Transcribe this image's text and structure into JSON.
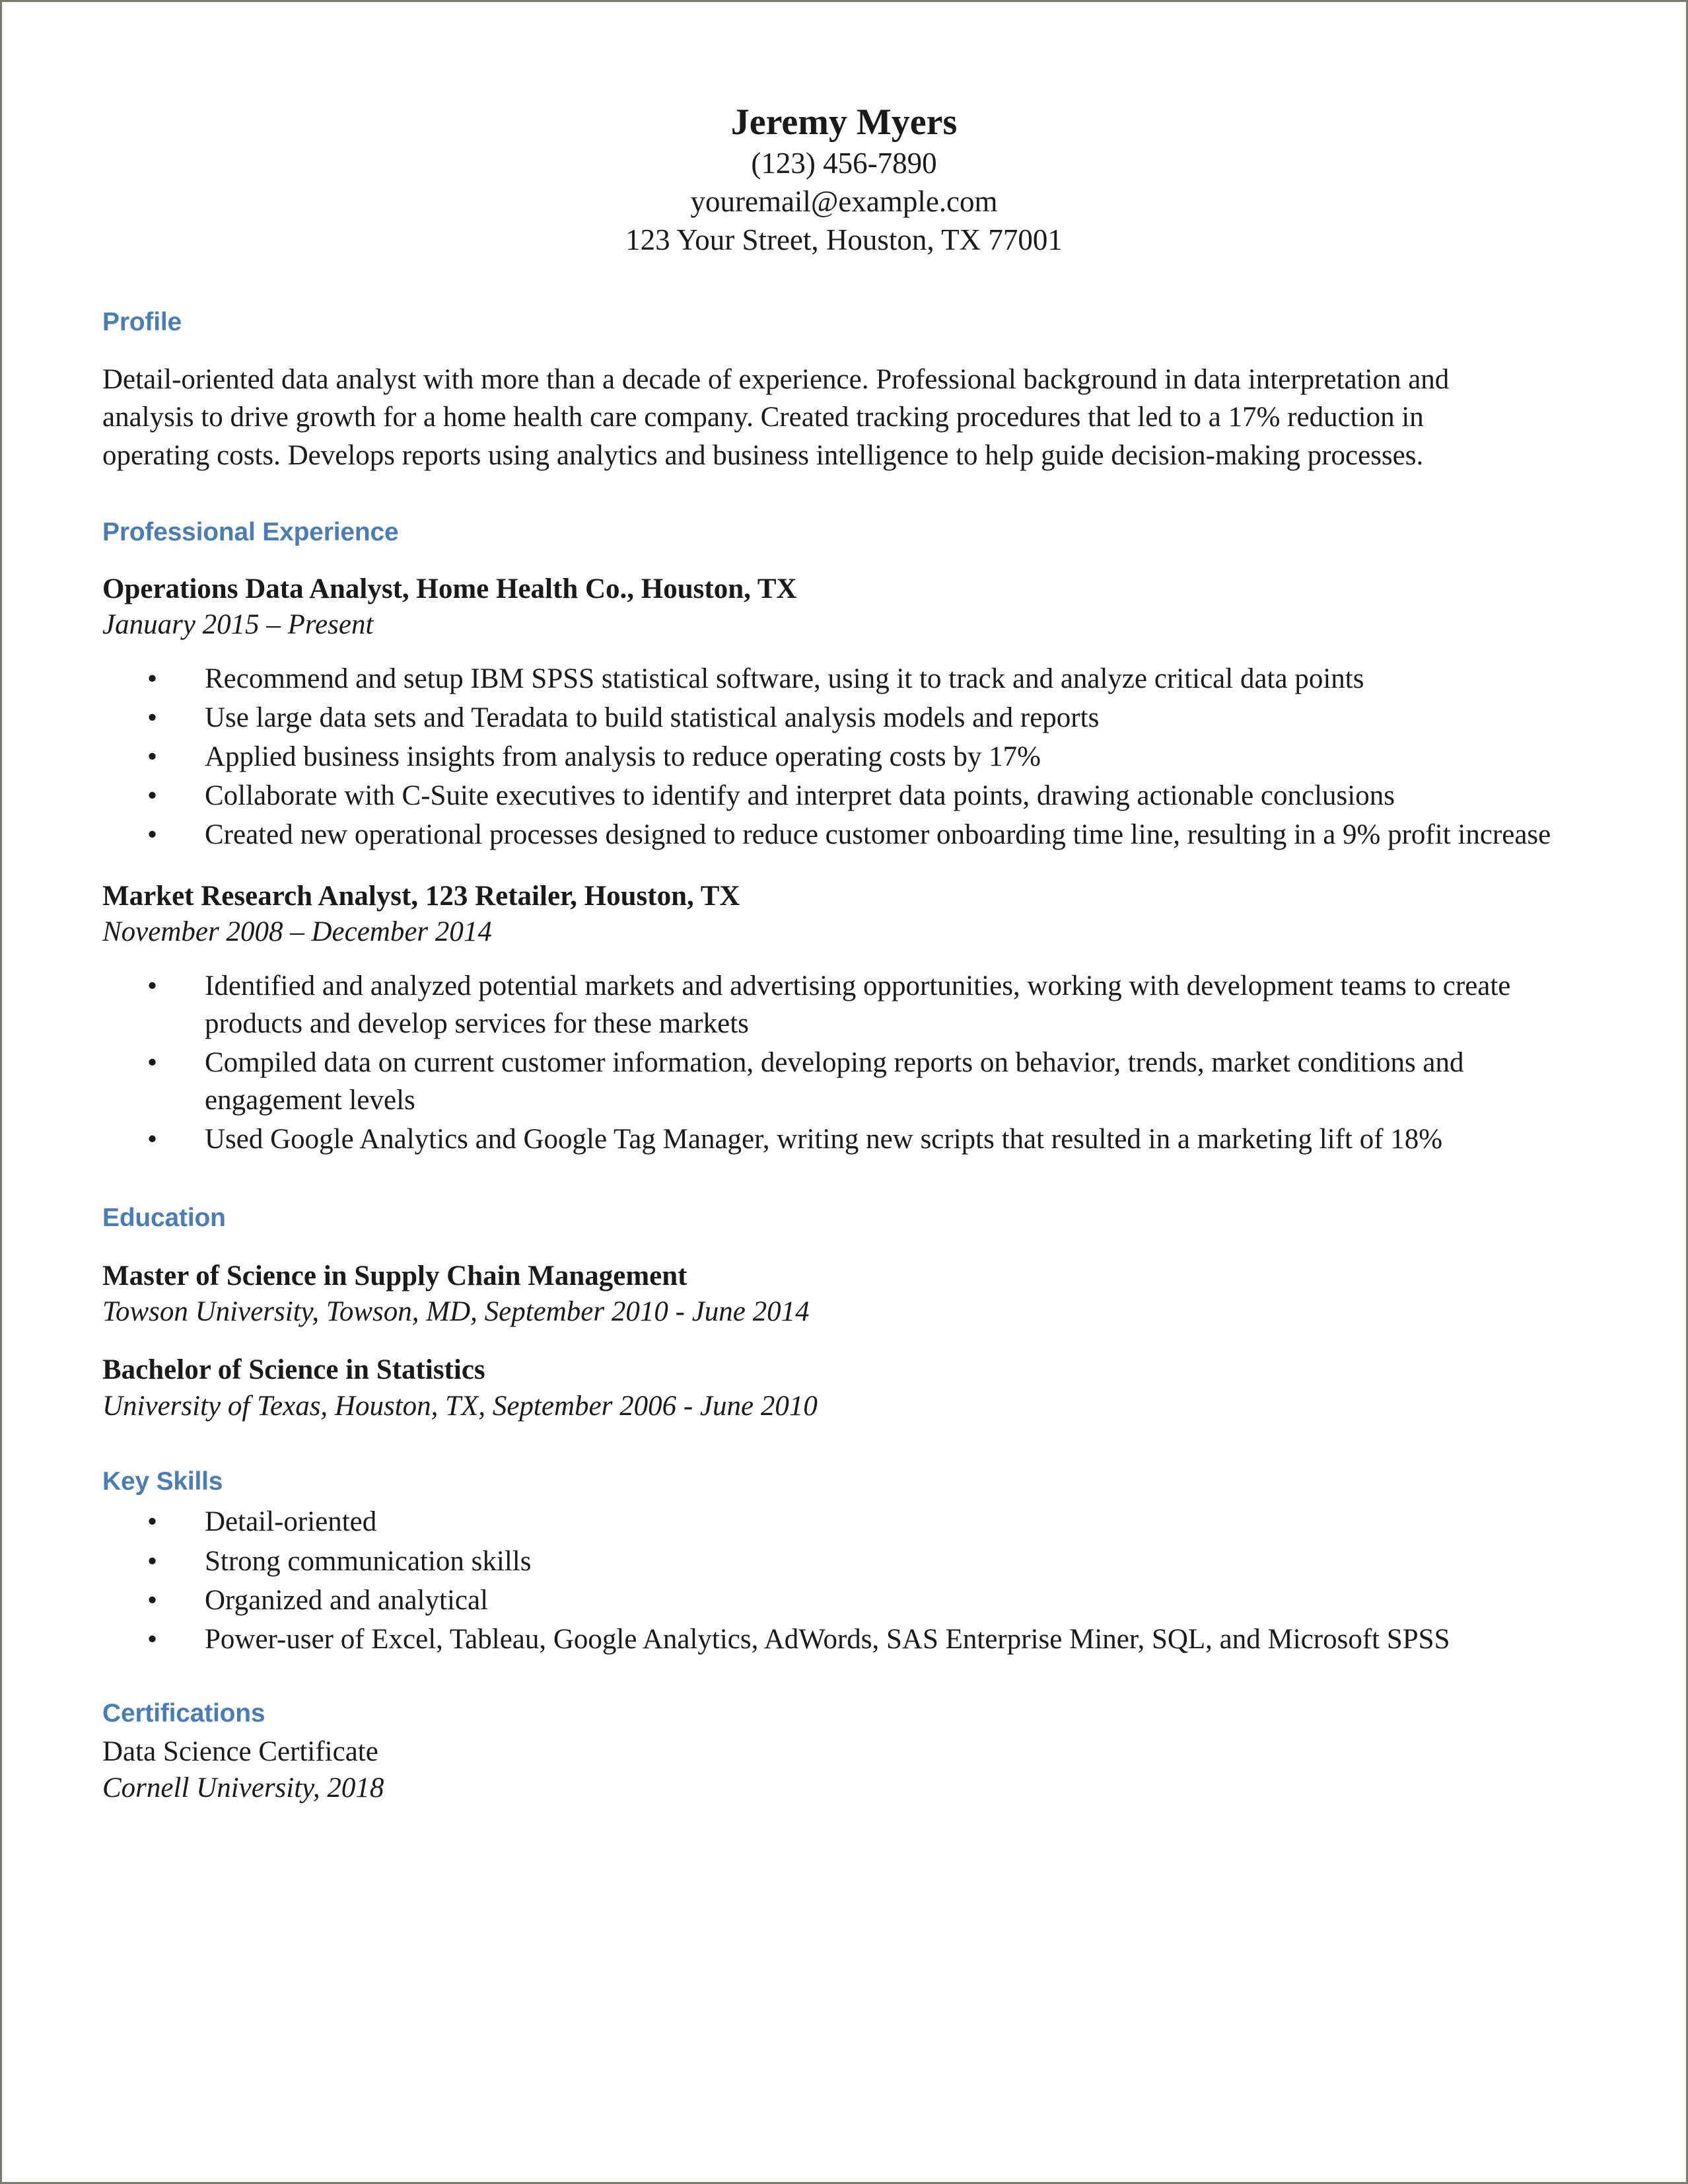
{
  "header": {
    "name": "Jeremy Myers",
    "phone": "(123) 456-7890",
    "email": "youremail@example.com",
    "address": "123 Your Street, Houston, TX 77001"
  },
  "profile": {
    "heading": "Profile",
    "text": "Detail-oriented data analyst with more than a decade of experience. Professional background in data interpretation and analysis to drive growth for a home health care company. Created tracking procedures that led to a 17% reduction in operating costs. Develops reports using analytics and business intelligence to help guide decision-making processes."
  },
  "experience": {
    "heading": "Professional Experience",
    "jobs": [
      {
        "title": "Operations Data Analyst, Home Health Co., Houston, TX",
        "dates": "January 2015 – Present",
        "bullets": [
          "Recommend and setup IBM SPSS statistical software, using it to track and analyze critical data points",
          "Use large data sets and Teradata to build statistical analysis models and reports",
          "Applied business insights from analysis to reduce operating costs by 17%",
          "Collaborate with C-Suite executives to identify and interpret data points, drawing actionable conclusions",
          "Created new operational processes designed to reduce customer onboarding time line, resulting in a 9% profit increase"
        ]
      },
      {
        "title": "Market Research Analyst, 123 Retailer, Houston, TX",
        "dates": "November 2008 – December 2014",
        "bullets": [
          "Identified and analyzed potential markets and advertising opportunities, working with development teams to create products and develop services for these markets",
          "Compiled data on current customer information, developing reports on behavior, trends, market conditions and engagement levels",
          "Used Google Analytics and Google Tag Manager, writing new scripts that resulted in a marketing lift of 18%"
        ]
      }
    ]
  },
  "education": {
    "heading": "Education",
    "entries": [
      {
        "degree": "Master of Science in Supply Chain Management",
        "school": "Towson University, Towson, MD, September 2010 - June 2014"
      },
      {
        "degree": "Bachelor of Science in Statistics",
        "school": "University of Texas, Houston, TX, September 2006 - June 2010"
      }
    ]
  },
  "skills": {
    "heading": "Key Skills",
    "items": [
      "Detail-oriented",
      "Strong communication skills",
      "Organized and analytical",
      "Power-user of Excel, Tableau, Google Analytics, AdWords, SAS Enterprise Miner, SQL, and Microsoft SPSS"
    ]
  },
  "certifications": {
    "heading": "Certifications",
    "name": "Data Science Certificate",
    "school": "Cornell University, 2018"
  },
  "bullet_glyph": "•",
  "colors": {
    "heading_blue": "#4a7db5",
    "text": "#1a1a1a",
    "page_border": "#7a7a6e"
  }
}
